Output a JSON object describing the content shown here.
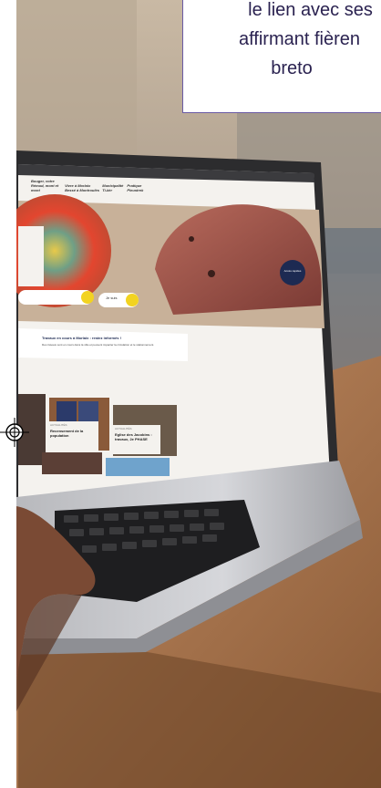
{
  "quote_box": {
    "lines": [
      "le lien avec ses",
      "affirmant fièren",
      "breto"
    ]
  },
  "site": {
    "nav": [
      "Bouger, votre Rémud, mont et mont",
      "Vivre à Morlaix Bessé à Montroulès",
      "Municipalité Ti-kèr",
      "Pratique Pleustrek"
    ],
    "search_placeholder": "Je suis",
    "quick_access": "Accès rapides",
    "news_banner_title": "Travaux en cours à Morlaix : restez informés !",
    "news_banner_text": "Des travaux sont en cours dans la ville et peuvent impacter la circulation et le stationnement.",
    "cards": [
      {
        "tag": "ACTUALITÉS",
        "title": "Recensement de la population"
      },
      {
        "tag": "ACTUALITÉS",
        "title": "Eglise des Jacobins : travaux, 2e PHASE"
      }
    ]
  },
  "colors": {
    "accent_yellow": "#f2d321",
    "navy": "#1d2a52",
    "quote_border": "#6b5ba5"
  }
}
